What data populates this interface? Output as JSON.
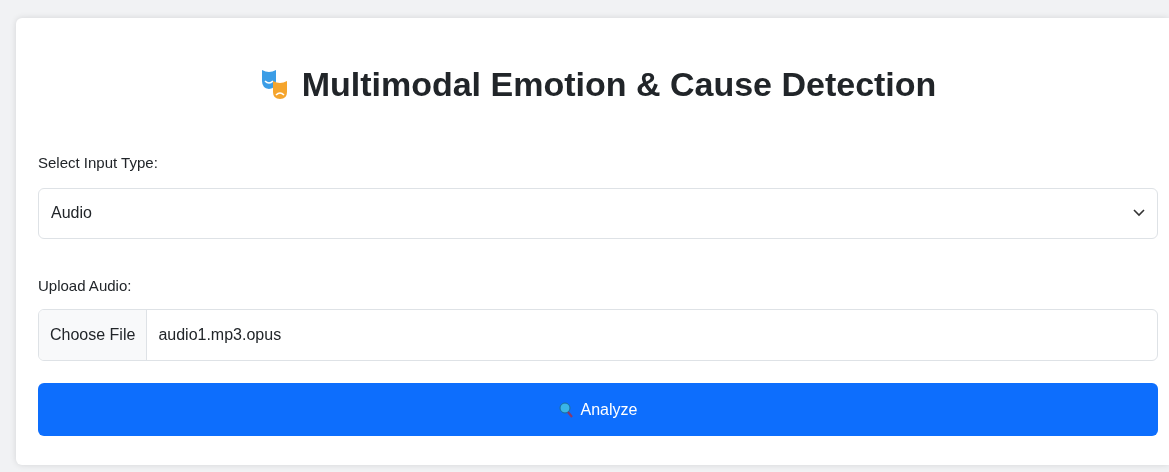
{
  "title": "Multimodal Emotion & Cause Detection",
  "input_type": {
    "label": "Select Input Type:",
    "value": "Audio"
  },
  "upload": {
    "label": "Upload Audio:",
    "button": "Choose File",
    "file_name": "audio1.mp3.opus"
  },
  "submit": {
    "label": "Analyze"
  }
}
